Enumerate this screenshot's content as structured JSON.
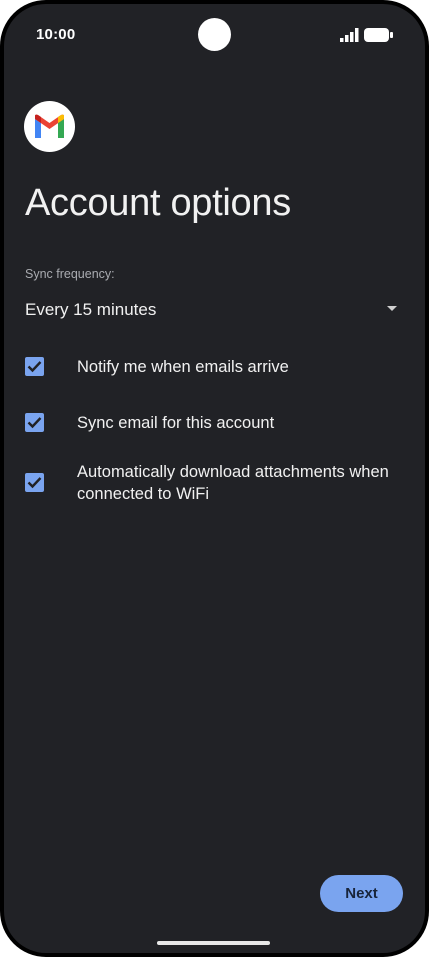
{
  "status_bar": {
    "time": "10:00"
  },
  "app": {
    "logo_icon": "gmail-logo-icon"
  },
  "page": {
    "title": "Account options"
  },
  "sync": {
    "label": "Sync frequency:",
    "value": "Every 15 minutes"
  },
  "options": [
    {
      "label": "Notify me when emails arrive",
      "checked": true
    },
    {
      "label": "Sync email for this account",
      "checked": true
    },
    {
      "label": "Automatically download attachments when connected to WiFi",
      "checked": true
    }
  ],
  "actions": {
    "next_label": "Next"
  },
  "colors": {
    "background": "#212226",
    "accent": "#7aa4ef",
    "text": "#f1f1f1",
    "muted": "#a9abb0"
  }
}
